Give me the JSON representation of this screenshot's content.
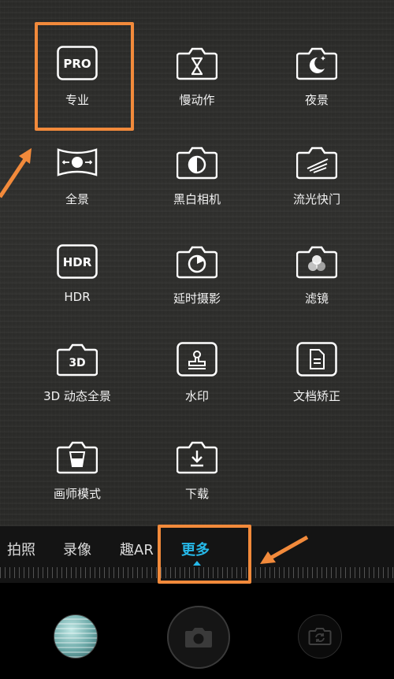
{
  "modes": [
    {
      "label": "专业",
      "icon": "pro-icon"
    },
    {
      "label": "慢动作",
      "icon": "slow-motion-icon"
    },
    {
      "label": "夜景",
      "icon": "night-mode-icon"
    },
    {
      "label": "全景",
      "icon": "panorama-icon"
    },
    {
      "label": "黑白相机",
      "icon": "monochrome-icon"
    },
    {
      "label": "流光快门",
      "icon": "light-painting-icon"
    },
    {
      "label": "HDR",
      "icon": "hdr-icon"
    },
    {
      "label": "延时摄影",
      "icon": "time-lapse-icon"
    },
    {
      "label": "滤镜",
      "icon": "filter-icon"
    },
    {
      "label": "3D 动态全景",
      "icon": "3d-panorama-icon"
    },
    {
      "label": "水印",
      "icon": "watermark-icon"
    },
    {
      "label": "文档矫正",
      "icon": "document-correction-icon"
    },
    {
      "label": "画师模式",
      "icon": "artist-mode-icon"
    },
    {
      "label": "下载",
      "icon": "download-icon"
    }
  ],
  "icon_text": {
    "pro": "PRO",
    "hdr": "HDR",
    "d3": "3D"
  },
  "tabs": [
    {
      "label": "拍照",
      "active": false
    },
    {
      "label": "录像",
      "active": false
    },
    {
      "label": "趣AR",
      "active": false
    },
    {
      "label": "更多",
      "active": true
    }
  ],
  "colors": {
    "accent": "#26b8e8",
    "annotation": "#f28a3b"
  }
}
